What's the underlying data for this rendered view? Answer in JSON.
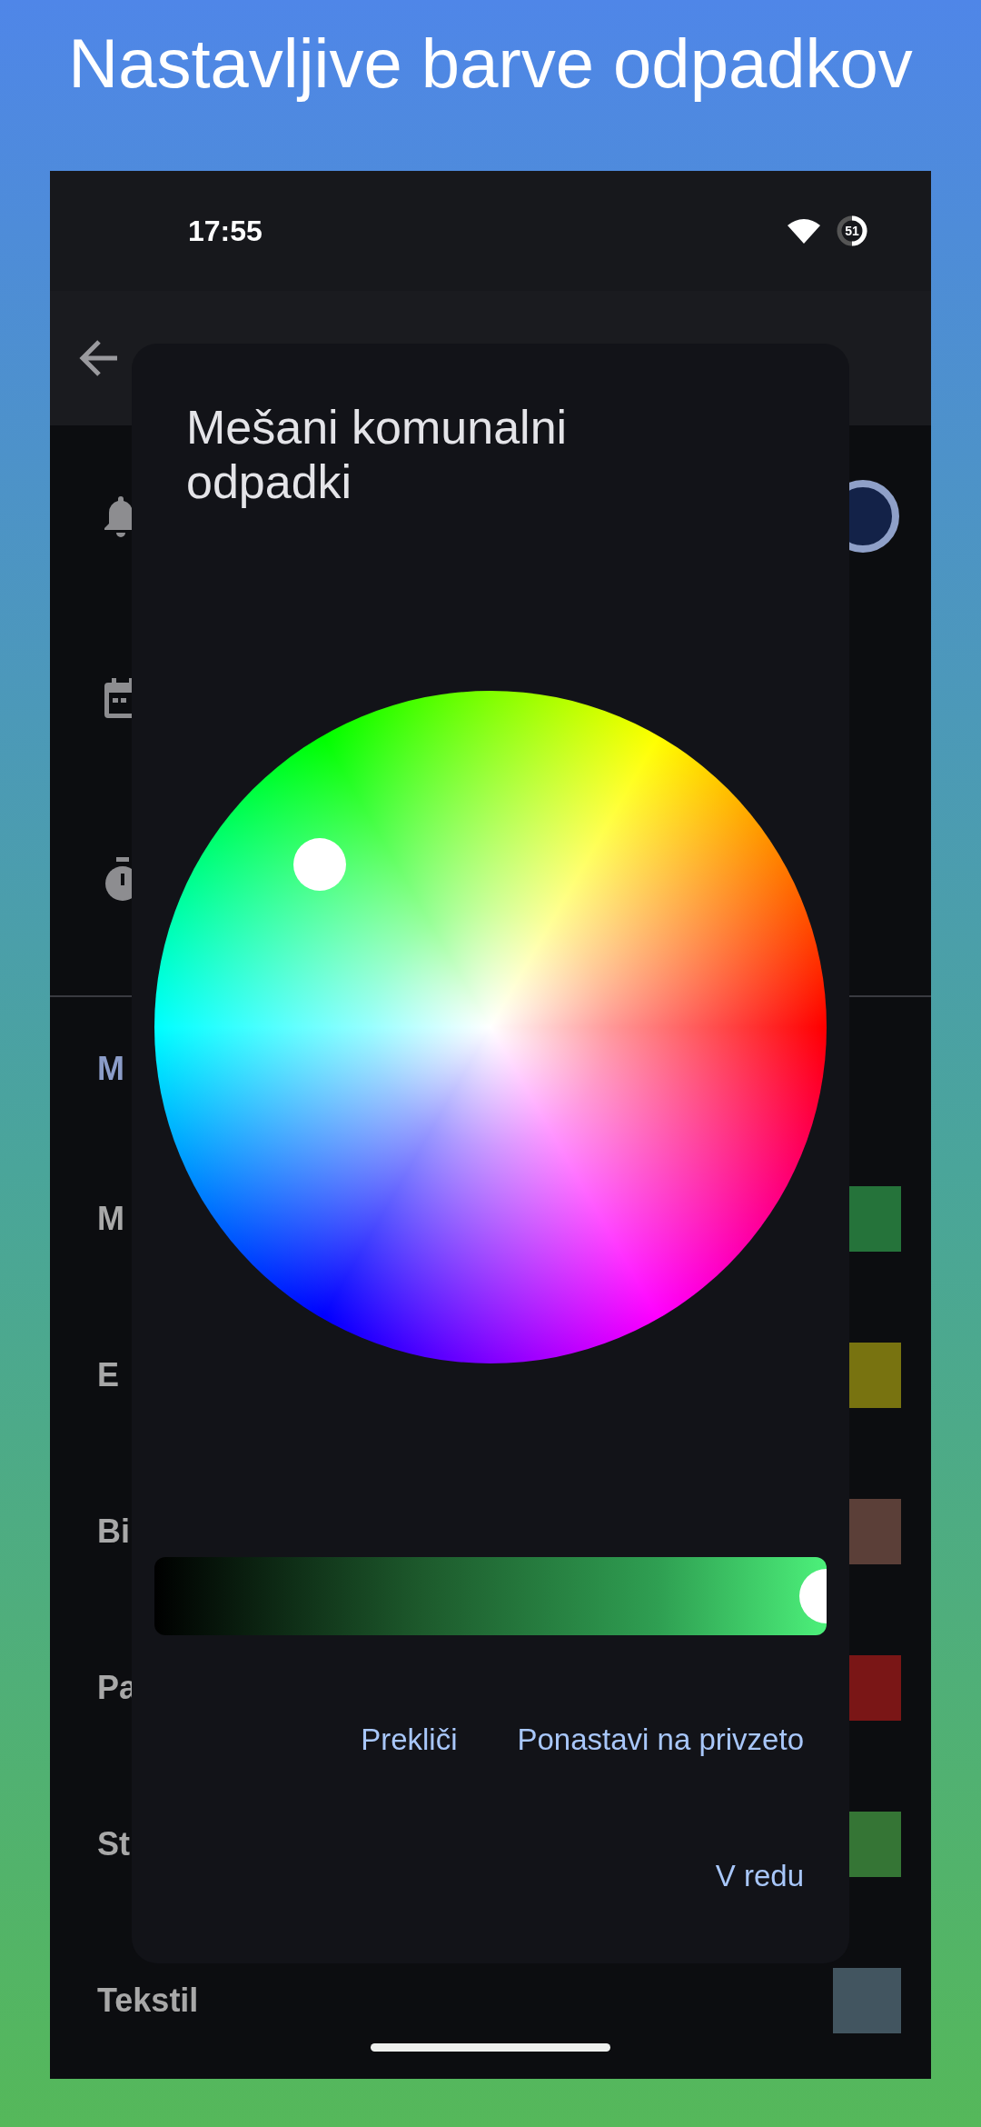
{
  "banner": {
    "title": "Nastavljive barve odpadkov"
  },
  "status_bar": {
    "time": "17:55",
    "battery": "51"
  },
  "section": {
    "title": "M"
  },
  "waste_types": [
    {
      "label": "M",
      "color": "#25733a"
    },
    {
      "label": "E",
      "color": "#787310"
    },
    {
      "label": "Bi",
      "color": "#5b3f38"
    },
    {
      "label": "Pa",
      "color": "#7a1616"
    },
    {
      "label": "St",
      "color": "#357535"
    },
    {
      "label": "Tekstil",
      "color": "#425560"
    }
  ],
  "dialog": {
    "title": "Mešani komunalni odpadki",
    "brightness": {
      "level": 1.0
    },
    "buttons": [
      {
        "label": "Prekliči",
        "kind": "cancel"
      },
      {
        "label": "Ponastavi na privzeto",
        "kind": "reset"
      },
      {
        "label": "V redu",
        "kind": "ok"
      }
    ]
  }
}
